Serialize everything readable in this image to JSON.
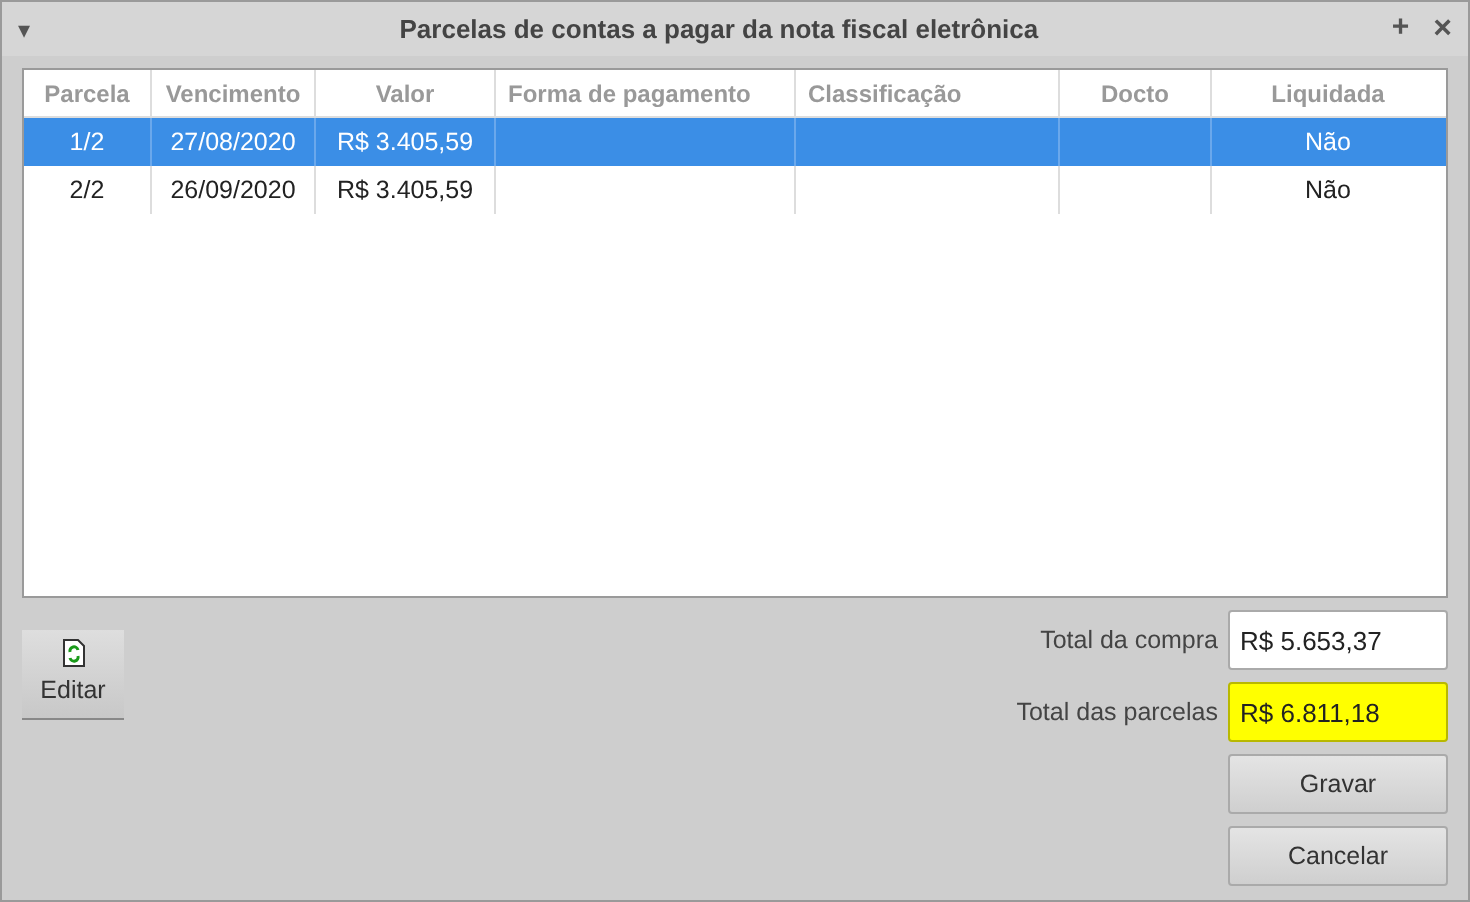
{
  "window": {
    "title": "Parcelas de contas a pagar da nota fiscal eletrônica",
    "menu_glyph": "▾",
    "maximize_glyph": "+",
    "close_glyph": "×"
  },
  "table": {
    "columns": [
      "Parcela",
      "Vencimento",
      "Valor",
      "Forma de pagamento",
      "Classificação",
      "Docto",
      "Liquidada"
    ],
    "rows": [
      {
        "selected": true,
        "cells": [
          "1/2",
          "27/08/2020",
          "R$ 3.405,59",
          "",
          "",
          "",
          "Não"
        ]
      },
      {
        "selected": false,
        "cells": [
          "2/2",
          "26/09/2020",
          "R$ 3.405,59",
          "",
          "",
          "",
          "Não"
        ]
      }
    ]
  },
  "edit_button": {
    "label": "Editar"
  },
  "fields": [
    {
      "label": "Total da compra",
      "value": "R$ 5.653,37",
      "highlighted": false
    },
    {
      "label": "Total das parcelas",
      "value": "R$ 6.811,18",
      "highlighted": true
    }
  ],
  "buttons": [
    "Gravar",
    "Cancelar"
  ]
}
